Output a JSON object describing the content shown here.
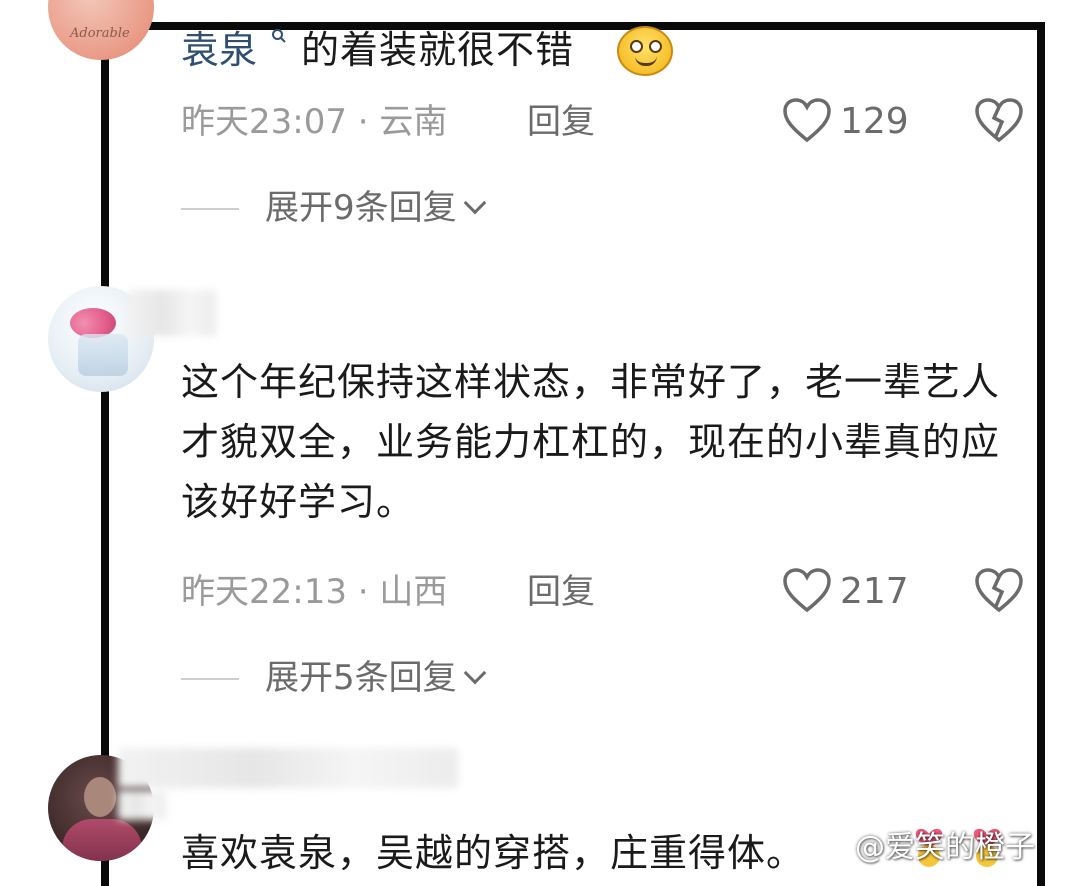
{
  "comments": [
    {
      "username": "袁泉",
      "text": "的着装就很不错",
      "emoji_icon": "smiley-emoji",
      "time": "昨天23:07 · 云南",
      "reply_label": "回复",
      "likes": "129",
      "expand_label": "展开9条回复"
    },
    {
      "text": "这个年纪保持这样状态，非常好了，老一辈艺人才貌双全，业务能力杠杠的，现在的小辈真的应该好好学习。",
      "time": "昨天22:13 · 山西",
      "reply_label": "回复",
      "likes": "217",
      "expand_label": "展开5条回复"
    },
    {
      "text": "喜欢袁泉，吴越的穿搭，庄重得体。"
    }
  ],
  "avatar1_text": "Adorable",
  "watermark": "@爱笑的橙子",
  "icons": {
    "like": "heart-outline-icon",
    "dislike": "broken-heart-icon",
    "expand": "chevron-down-icon",
    "search": "search-icon"
  },
  "colors": {
    "username": "#2f4f72",
    "meta": "#9a9a9a",
    "frame": "#0a0a0a"
  }
}
